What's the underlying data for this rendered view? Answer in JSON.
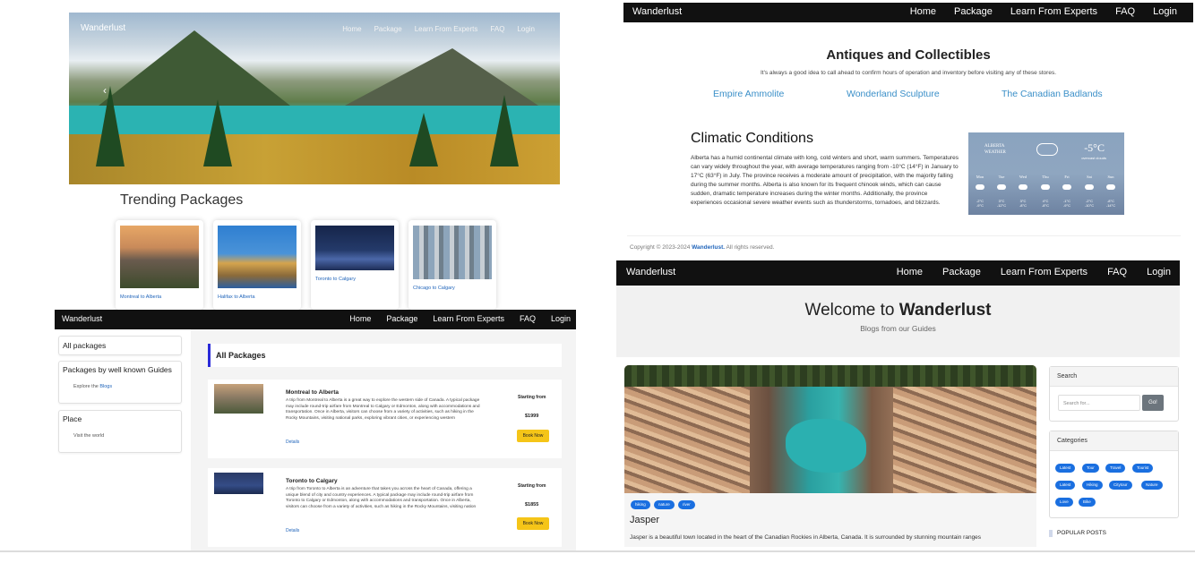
{
  "panel1": {
    "brand": "Wanderlust",
    "nav": [
      "Home",
      "Package",
      "Learn From Experts",
      "FAQ",
      "Login"
    ],
    "prev_glyph": "‹",
    "trending_title": "Trending Packages",
    "cards": [
      {
        "label": "Montreal to Alberta"
      },
      {
        "label": "Halifax to Alberta"
      },
      {
        "label": "Toronto to Calgary"
      },
      {
        "label": "Chicago to Calgary"
      }
    ]
  },
  "panel2": {
    "brand": "Wanderlust",
    "nav": [
      "Home",
      "Package",
      "Learn From Experts",
      "FAQ",
      "Login"
    ],
    "antiques_title": "Antiques and Collectibles",
    "antiques_sub": "It's always a good idea to call ahead to confirm hours of operation and inventory before visiting any of these stores.",
    "stores": [
      "Empire Ammolite",
      "Wonderland Sculpture",
      "The Canadian Badlands"
    ],
    "climate_title": "Climatic Conditions",
    "climate_text": "Alberta has a humid continental climate with long, cold winters and short, warm summers. Temperatures can vary widely throughout the year, with average temperatures ranging from -10°C (14°F) in January to 17°C (63°F) in July. The province receives a moderate amount of precipitation, with the majority falling during the summer months. Alberta is also known for its frequent chinook winds, which can cause sudden, dramatic temperature increases during the winter months. Additionally, the province experiences occasional severe weather events such as thunderstorms, tornadoes, and blizzards.",
    "weather": {
      "label_line1": "ALBERTA",
      "label_line2": "WEATHER",
      "temp": "-5°C",
      "condition": "overcast clouds",
      "days": [
        "Mon",
        "Tue",
        "Wed",
        "Thu",
        "Fri",
        "Sat",
        "Sun"
      ],
      "highs": [
        "-2°C",
        "3°C",
        "3°C",
        "4°C",
        "-1°C",
        "-2°C",
        "-8°C"
      ],
      "lows": [
        "-9°C",
        "-12°C",
        "-8°C",
        "-8°C",
        "-9°C",
        "-10°C",
        "-14°C"
      ]
    },
    "copyright_prefix": "Copyright © 2023-2024",
    "copyright_brand": "Wanderlust.",
    "copyright_suffix": "All rights reserved."
  },
  "panel3": {
    "brand": "Wanderlust",
    "nav": [
      "Home",
      "Package",
      "Learn From Experts",
      "FAQ",
      "Login"
    ],
    "side": {
      "all": "All packages",
      "guides_title": "Packages by well known Guides",
      "guides_sub_prefix": "Explore the",
      "guides_sub_link": "Blogs",
      "place_title": "Place",
      "place_sub": "Visit the world"
    },
    "main_title": "All Packages",
    "packages": [
      {
        "title": "Montreal to Alberta",
        "desc": "A trip from Montreal to Alberta is a great way to explore the western side of Canada. A typical package may include round-trip airfare from Montreal to Calgary or Edmonton, along with accommodations and transportation. Once in Alberta, visitors can choose from a variety of activities, such as hiking in the Rocky Mountains, visiting national parks, exploring vibrant cities, or experiencing western",
        "details": "Details",
        "starting": "Starting from",
        "price": "$1999",
        "book": "Book Now"
      },
      {
        "title": "Toronto to Calgary",
        "desc": "A trip from Toronto to Alberta is an adventure that takes you across the heart of Canada, offering a unique blend of city and country experiences. A typical package may include round-trip airfare from Toronto to Calgary or Edmonton, along with accommodations and transportation. Once in Alberta, visitors can choose from a variety of activities, such as hiking in the Rocky Mountains, visiting nation",
        "details": "Details",
        "starting": "Starting from",
        "price": "$1855",
        "book": "Book Now"
      }
    ]
  },
  "panel4": {
    "brand": "Wanderlust",
    "nav": [
      "Home",
      "Package",
      "Learn From Experts",
      "FAQ",
      "Login"
    ],
    "welcome_prefix": "Welcome to",
    "welcome_brand": "Wanderlust",
    "blogs_sub_prefix": "Blogs from our",
    "blogs_sub_link": "Guides",
    "post_tags": [
      "hiking",
      "nature",
      "river"
    ],
    "post_title": "Jasper",
    "post_text": "Jasper is a beautiful town located in the heart of the Canadian Rockies in Alberta, Canada. It is surrounded by stunning mountain ranges",
    "search_title": "Search",
    "search_placeholder": "Search for...",
    "search_button": "Go!",
    "categories_title": "Categories",
    "categories": [
      "Latest",
      "Tour",
      "Travel",
      "Tourist",
      "Latest",
      "Hiking",
      "Citytour",
      "Nature",
      "Love",
      "Bike"
    ],
    "popular_title": "POPULAR POSTS"
  },
  "colors": {
    "nav_bg": "#111111",
    "link": "#3a8fc8",
    "accent_blue": "#1a6fe0",
    "book_button": "#f5c518",
    "section_marker": "#2a2ad8"
  },
  "icons": [
    "chevron-left-icon",
    "cloud-icon",
    "weather-cloud-icon"
  ]
}
